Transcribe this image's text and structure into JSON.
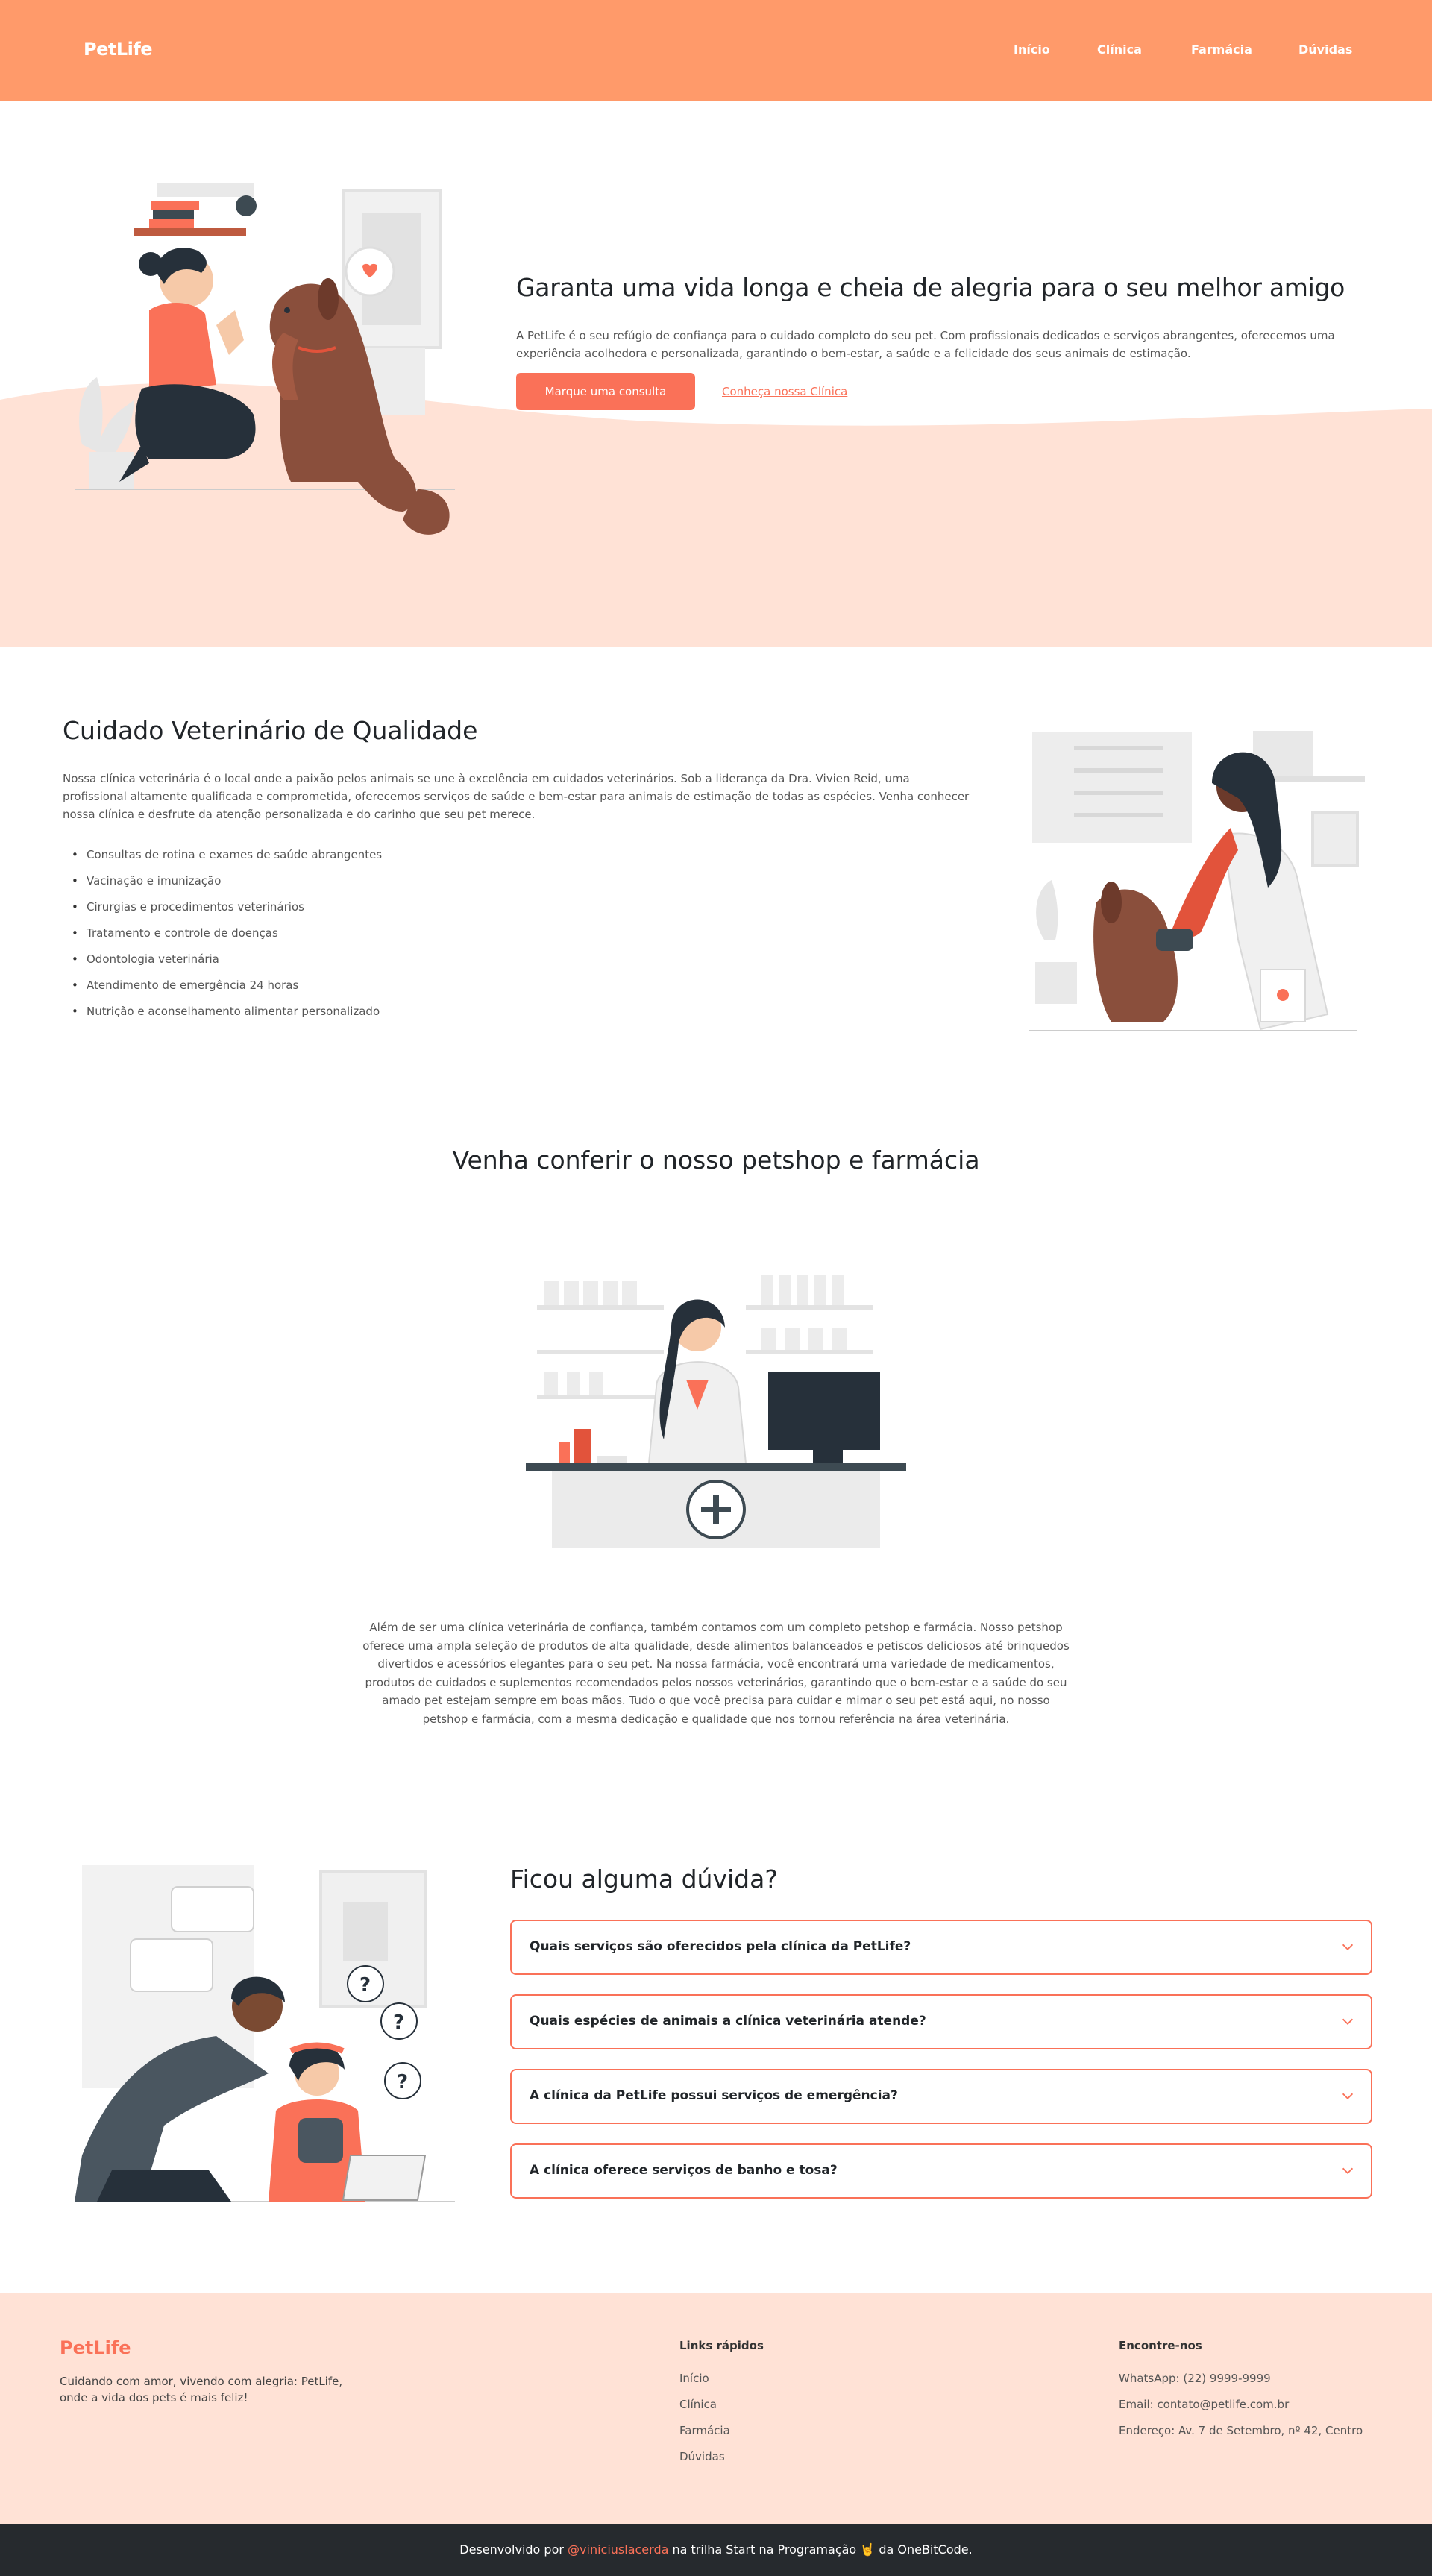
{
  "nav": {
    "brand": "PetLife",
    "links": [
      "Início",
      "Clínica",
      "Farmácia",
      "Dúvidas"
    ]
  },
  "hero": {
    "title": "Garanta uma vida longa e cheia de alegria para o seu melhor amigo",
    "text": "A PetLife é o seu refúgio de confiança para o cuidado completo do seu pet. Com profissionais dedicados e serviços abrangentes, oferecemos uma experiência acolhedora e personalizada, garantindo o bem-estar, a saúde e a felicidade dos seus animais de estimação.",
    "primary_button": "Marque uma consulta",
    "secondary_link": "Conheça nossa Clínica"
  },
  "clinic": {
    "title": "Cuidado Veterinário de Qualidade",
    "text": "Nossa clínica veterinária é o local onde a paixão pelos animais se une à excelência em cuidados veterinários. Sob a liderança da Dra. Vivien Reid, uma profissional altamente qualificada e comprometida, oferecemos serviços de saúde e bem-estar para animais de estimação de todas as espécies. Venha conhecer nossa clínica e desfrute da atenção personalizada e do carinho que seu pet merece.",
    "services": [
      "Consultas de rotina e exames de saúde abrangentes",
      "Vacinação e imunização",
      "Cirurgias e procedimentos veterinários",
      "Tratamento e controle de doenças",
      "Odontologia veterinária",
      "Atendimento de emergência 24 horas",
      "Nutrição e aconselhamento alimentar personalizado"
    ]
  },
  "shop": {
    "title": "Venha conferir o nosso petshop e farmácia",
    "text": "Além de ser uma clínica veterinária de confiança, também contamos com um completo petshop e farmácia. Nosso petshop oferece uma ampla seleção de produtos de alta qualidade, desde alimentos balanceados e petiscos deliciosos até brinquedos divertidos e acessórios elegantes para o seu pet. Na nossa farmácia, você encontrará uma variedade de medicamentos, produtos de cuidados e suplementos recomendados pelos nossos veterinários, garantindo que o bem-estar e a saúde do seu amado pet estejam sempre em boas mãos. Tudo o que você precisa para cuidar e mimar o seu pet está aqui, no nosso petshop e farmácia, com a mesma dedicação e qualidade que nos tornou referência na área veterinária."
  },
  "faq": {
    "title": "Ficou alguma dúvida?",
    "questions": [
      "Quais serviços são oferecidos pela clínica da PetLife?",
      "Quais espécies de animais a clínica veterinária atende?",
      "A clínica da PetLife possui serviços de emergência?",
      "A clínica oferece serviços de banho e tosa?"
    ]
  },
  "footer": {
    "brand": "PetLife",
    "tagline": "Cuidando com amor, vivendo com alegria: PetLife, onde a vida dos pets é mais feliz!",
    "quick_links_title": "Links rápidos",
    "quick_links": [
      "Início",
      "Clínica",
      "Farmácia",
      "Dúvidas"
    ],
    "contact_title": "Encontre-nos",
    "contact": [
      "WhatsApp: (22) 9999-9999",
      "Email: contato@petlife.com.br",
      "Endereço: Av. 7 de Setembro, nº 42, Centro"
    ]
  },
  "credits": {
    "prefix": "Desenvolvido por",
    "author": "@viniciuslacerda",
    "middle": "na trilha Start na Programação",
    "emoji": "🤘",
    "suffix": "da OneBitCode."
  },
  "colors": {
    "nav_bg": "#ff9a6a",
    "accent": "#fa7158",
    "hero_wave": "#ffe2d6",
    "footer_bg": "#ffe2d6",
    "credits_bg": "#262a2e"
  },
  "icons": {
    "faq_toggle": "chevron-down-icon"
  }
}
